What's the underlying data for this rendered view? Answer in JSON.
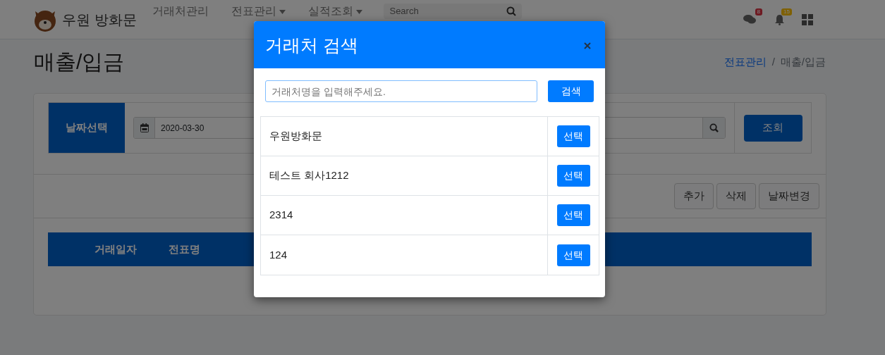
{
  "navbar": {
    "brand": "우원 방화문",
    "items": [
      {
        "label": "거래처관리",
        "dropdown": false
      },
      {
        "label": "전표관리",
        "dropdown": true
      },
      {
        "label": "실적조회",
        "dropdown": true
      }
    ],
    "search": {
      "placeholder": "Search"
    },
    "badges": [
      {
        "kind": "messages",
        "count": "8"
      },
      {
        "kind": "notifications",
        "count": "15"
      }
    ]
  },
  "page": {
    "title": "매출/입금",
    "breadcrumb": [
      {
        "label": "전표관리",
        "link": true
      },
      {
        "label": "매출/입금",
        "link": false
      }
    ],
    "breadcrumb_separator": "/"
  },
  "filter": {
    "label": "날짜선택",
    "date": "2020-03-30",
    "button": "조회"
  },
  "actions": [
    "추가",
    "삭제",
    "날짜변경"
  ],
  "table": {
    "columns": [
      "거래일자",
      "전표명"
    ]
  },
  "modal": {
    "title": "거래처 검색",
    "search": {
      "placeholder": "거래처명을 입력해주세요."
    },
    "search_button": "검색",
    "rows": [
      {
        "name": "우원방화문",
        "button": "선택"
      },
      {
        "name": "테스트 회사1212",
        "button": "선택"
      },
      {
        "name": "2314",
        "button": "선택"
      },
      {
        "name": "124",
        "button": "선택"
      }
    ]
  }
}
